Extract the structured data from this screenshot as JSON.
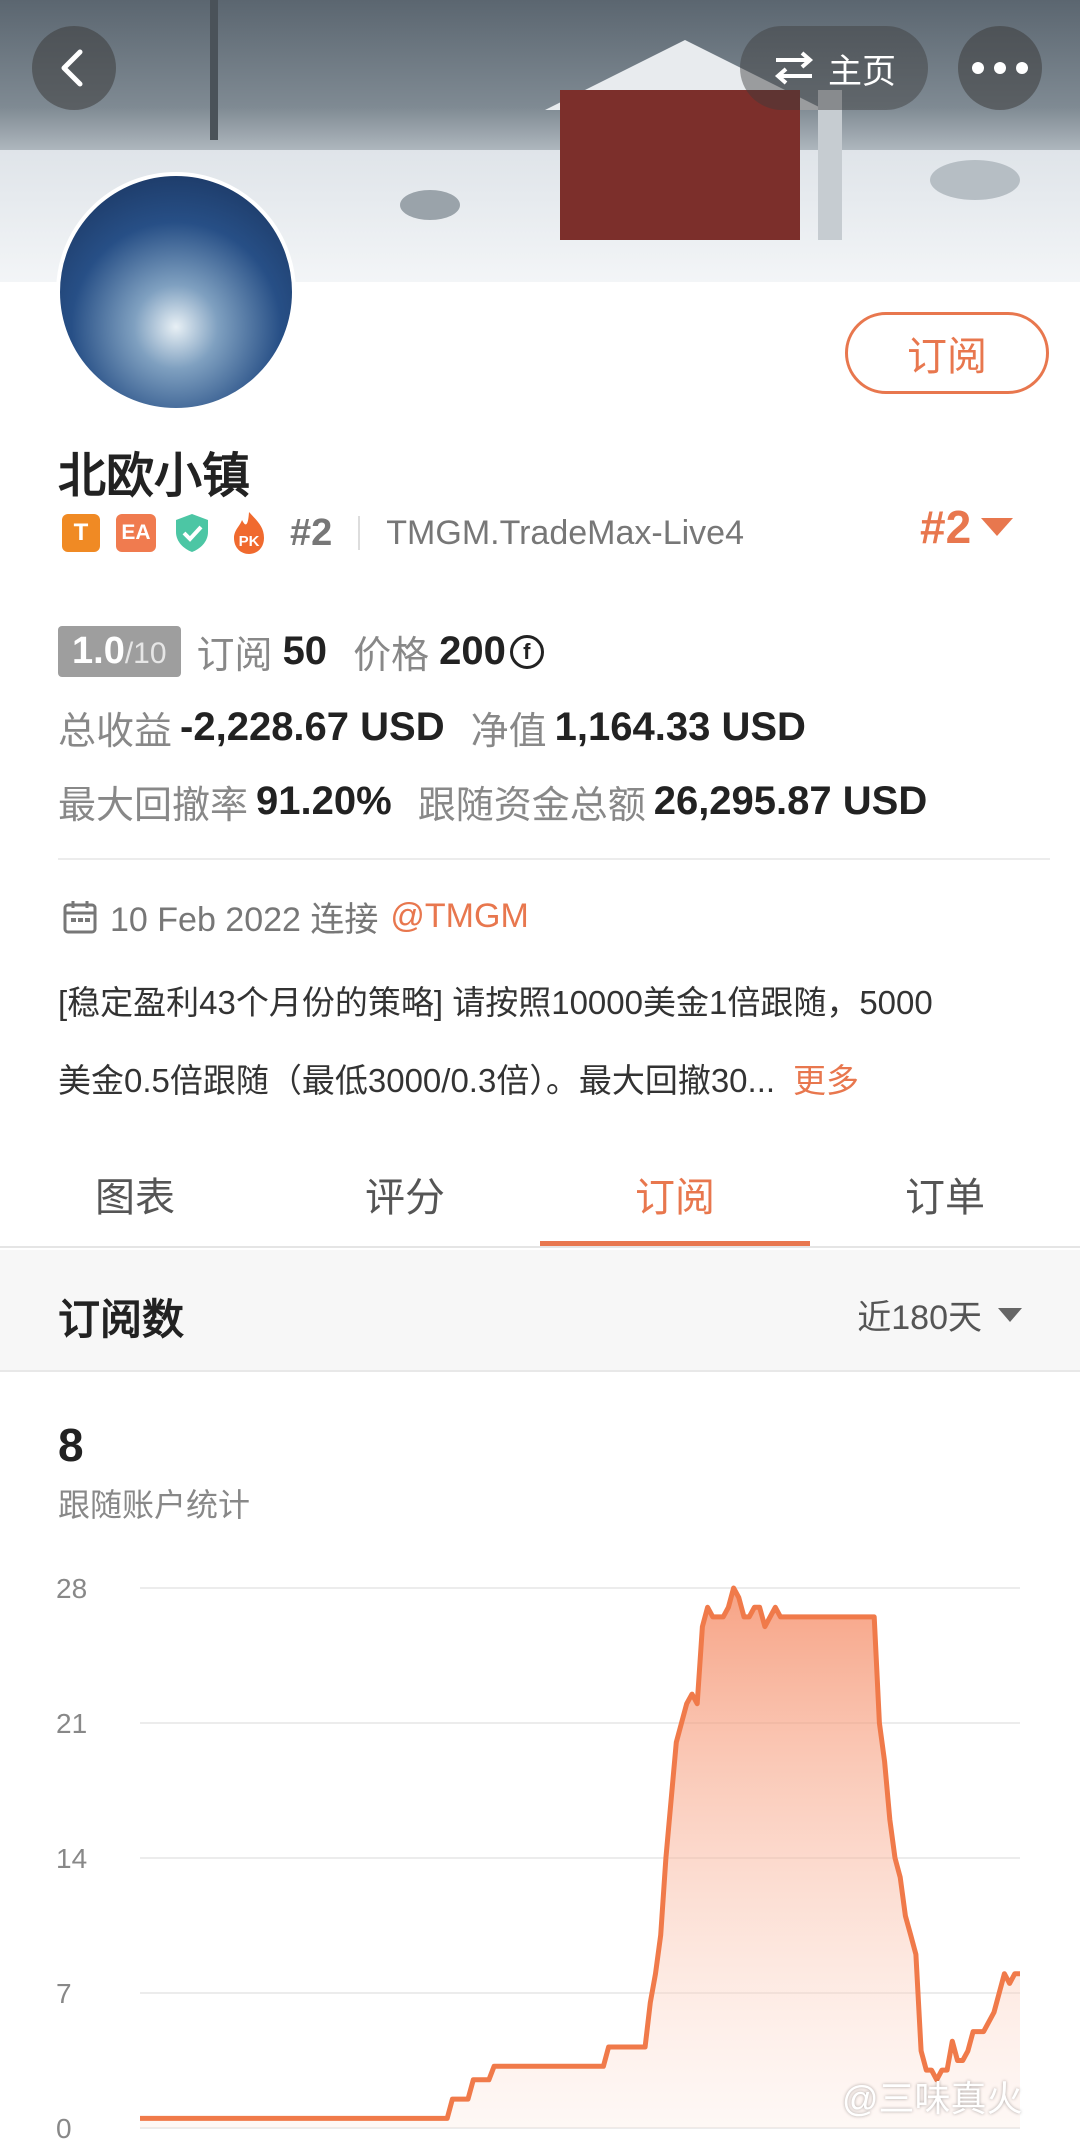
{
  "header": {
    "home_label": "主页"
  },
  "profile": {
    "subscribe_label": "订阅",
    "name": "北欧小镇",
    "badges": [
      "T",
      "EA",
      "PK"
    ],
    "rank": "#2",
    "server": "TMGM.TradeMax-Live4",
    "rank_right": "#2"
  },
  "stats": {
    "score": "1.0",
    "score_max": "/10",
    "subscribe_label": "订阅",
    "subscribe_count": "50",
    "price_label": "价格",
    "price_value": "200",
    "coin_symbol": "f",
    "total_profit_label": "总收益",
    "total_profit_value": "-2,228.67 USD",
    "equity_label": "净值",
    "equity_value": "1,164.33 USD",
    "max_drawdown_label": "最大回撤率",
    "max_drawdown_value": "91.20%",
    "follow_funds_label": "跟随资金总额",
    "follow_funds_value": "26,295.87 USD"
  },
  "info": {
    "date": "10 Feb 2022 连接",
    "broker": "@TMGM",
    "desc_line1": "[稳定盈利43个月份的策略] 请按照10000美金1倍跟随，5000",
    "desc_line2": "美金0.5倍跟随（最低3000/0.3倍）。最大回撤30...",
    "more_label": "更多"
  },
  "tabs": [
    {
      "label": "图表"
    },
    {
      "label": "评分"
    },
    {
      "label": "订阅"
    },
    {
      "label": "订单"
    }
  ],
  "section": {
    "title": "订阅数",
    "range_label": "近180天"
  },
  "summary": {
    "count": "8",
    "caption": "跟随账户统计"
  },
  "watermark": "@三味真火",
  "colors": {
    "accent": "#e8774e",
    "line": "#f07a4a"
  },
  "icons": [
    "back-arrow-icon",
    "swap-icon",
    "more-dots-icon",
    "calendar-icon",
    "chevron-down-icon",
    "shield-icon",
    "fire-icon",
    "coin-icon"
  ],
  "chart_data": {
    "type": "area",
    "title": "",
    "xlabel": "",
    "ylabel": "",
    "ylim": [
      0,
      28
    ],
    "yticks": [
      0,
      7,
      14,
      21,
      28
    ],
    "grid": true,
    "series": [
      {
        "values": [
          0.5,
          0.5,
          0.5,
          0.5,
          0.5,
          0.5,
          0.5,
          0.5,
          0.5,
          0.5,
          0.5,
          0.5,
          0.5,
          0.5,
          0.5,
          0.5,
          0.5,
          0.5,
          0.5,
          0.5,
          0.5,
          0.5,
          0.5,
          0.5,
          0.5,
          0.5,
          0.5,
          0.5,
          0.5,
          0.5,
          0.5,
          0.5,
          0.5,
          0.5,
          0.5,
          0.5,
          0.5,
          0.5,
          0.5,
          0.5,
          0.5,
          0.5,
          0.5,
          0.5,
          0.5,
          0.5,
          0.5,
          0.5,
          0.5,
          0.5,
          0.5,
          0.5,
          0.5,
          0.5,
          0.5,
          0.5,
          0.5,
          0.5,
          0.5,
          0.5,
          1.5,
          1.5,
          1.5,
          1.5,
          2.5,
          2.5,
          2.5,
          2.5,
          3.2,
          3.2,
          3.2,
          3.2,
          3.2,
          3.2,
          3.2,
          3.2,
          3.2,
          3.2,
          3.2,
          3.2,
          3.2,
          3.2,
          3.2,
          3.2,
          3.2,
          3.2,
          3.2,
          3.2,
          3.2,
          3.2,
          4.2,
          4.2,
          4.2,
          4.2,
          4.2,
          4.2,
          4.2,
          4.2,
          6.5,
          8,
          10,
          14,
          17,
          20,
          21,
          22,
          22.5,
          22,
          26,
          27,
          26.5,
          26.5,
          26.5,
          27,
          28,
          27.5,
          26.5,
          26.5,
          27,
          27,
          26,
          26.5,
          27,
          26.5,
          26.5,
          26.5,
          26.5,
          26.5,
          26.5,
          26.5,
          26.5,
          26.5,
          26.5,
          26.5,
          26.5,
          26.5,
          26.5,
          26.5,
          26.5,
          26.5,
          26.5,
          26.5,
          21,
          19,
          16,
          14,
          13,
          11,
          10,
          9,
          4,
          3,
          3,
          2.5,
          3,
          3,
          4.5,
          3.5,
          3.5,
          4,
          5,
          5,
          5,
          5.5,
          6,
          7,
          8,
          7.5,
          8,
          8
        ]
      }
    ]
  }
}
